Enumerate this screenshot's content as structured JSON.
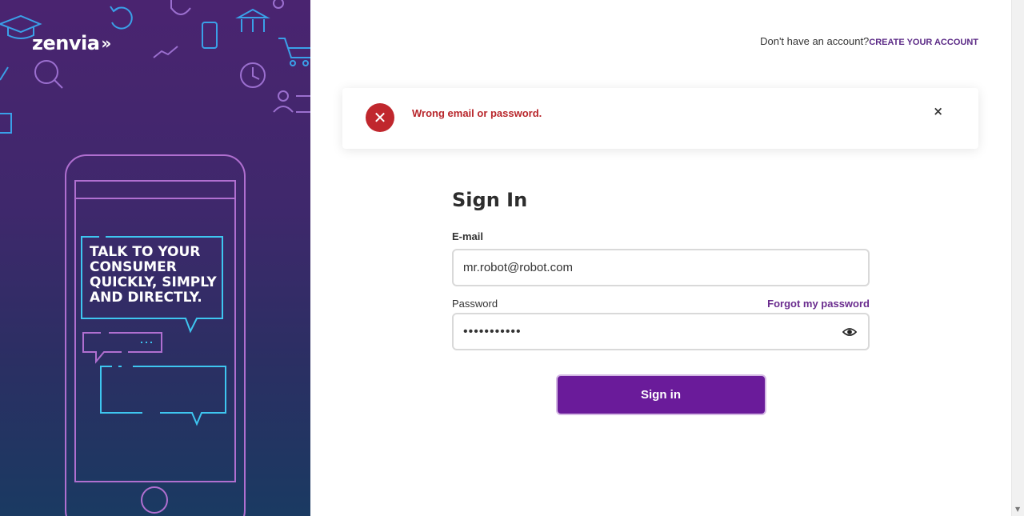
{
  "brand": {
    "logo_text": "zenvia",
    "logo_mark": "»"
  },
  "hero": {
    "tagline": "TALK TO YOUR CONSUMER QUICKLY, SIMPLY AND DIRECTLY."
  },
  "header": {
    "account_prompt": "Don't have an account?",
    "create_account_link": "CREATE YOUR ACCOUNT"
  },
  "alert": {
    "icon": "error-x-icon",
    "message": "Wrong email or password.",
    "close_symbol": "×",
    "color": "#c0272d"
  },
  "form": {
    "title": "Sign In",
    "email_label": "E-mail",
    "email_value": "mr.robot@robot.com",
    "password_label": "Password",
    "forgot_link": "Forgot my password",
    "password_value": "•••••••••••",
    "submit_label": "Sign in"
  },
  "colors": {
    "primary": "#6a1b9a",
    "accent_link": "#5b2a86",
    "error": "#b8262b"
  }
}
